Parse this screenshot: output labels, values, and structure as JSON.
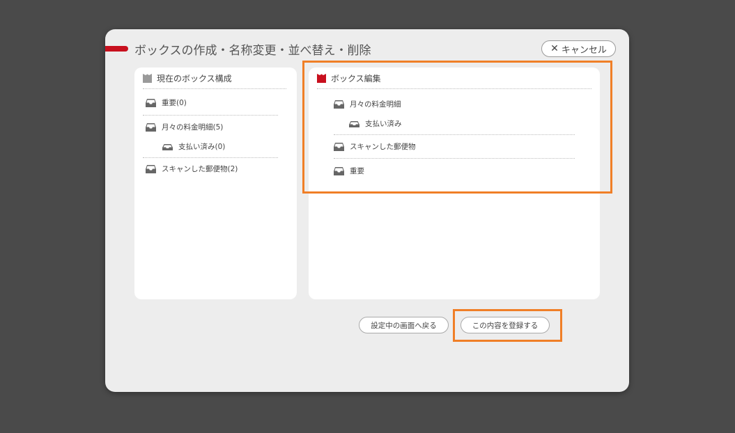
{
  "dialog": {
    "title": "ボックスの作成・名称変更・並べ替え・削除",
    "cancel_label": "キャンセル",
    "accent_color": "#c8101e",
    "highlight_color": "#f07f27"
  },
  "current_panel": {
    "title": "現在のボックス構成",
    "items": [
      {
        "label": "重要(0)"
      },
      {
        "label": "月々の料金明細(5)"
      },
      {
        "label": "支払い済み(0)"
      },
      {
        "label": "スキャンした郵便物(2)"
      }
    ]
  },
  "edit_panel": {
    "title": "ボックス編集",
    "items": [
      {
        "label": "月々の料金明細"
      },
      {
        "label": "支払い済み"
      },
      {
        "label": "スキャンした郵便物"
      },
      {
        "label": "重要"
      }
    ]
  },
  "footer": {
    "back_label": "設定中の画面へ戻る",
    "register_label": "この内容を登録する"
  }
}
